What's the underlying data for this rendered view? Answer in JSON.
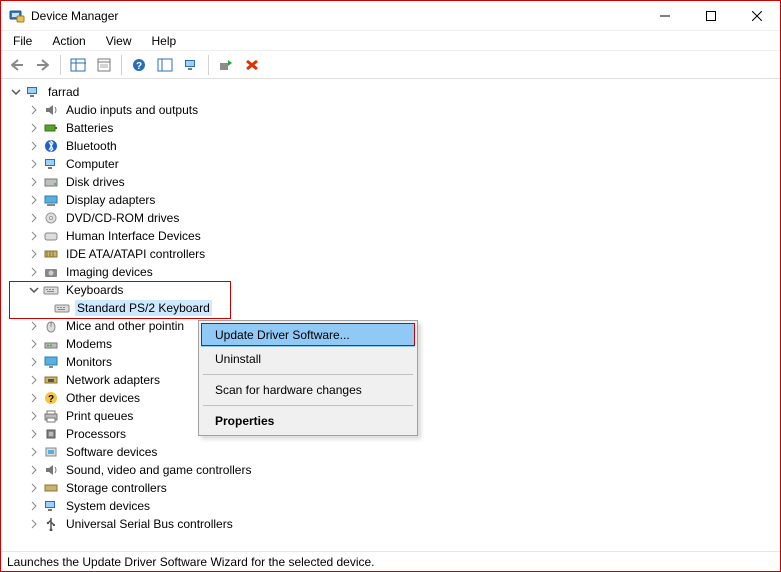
{
  "window": {
    "title": "Device Manager"
  },
  "menu": {
    "file": "File",
    "action": "Action",
    "view": "View",
    "help": "Help"
  },
  "tree": {
    "root": "farrad",
    "items": [
      "Audio inputs and outputs",
      "Batteries",
      "Bluetooth",
      "Computer",
      "Disk drives",
      "Display adapters",
      "DVD/CD-ROM drives",
      "Human Interface Devices",
      "IDE ATA/ATAPI controllers",
      "Imaging devices",
      "Keyboards",
      "Mice and other pointin",
      "Modems",
      "Monitors",
      "Network adapters",
      "Other devices",
      "Print queues",
      "Processors",
      "Software devices",
      "Sound, video and game controllers",
      "Storage controllers",
      "System devices",
      "Universal Serial Bus controllers"
    ],
    "keyboard_child": "Standard PS/2 Keyboard"
  },
  "context_menu": {
    "update": "Update Driver Software...",
    "uninstall": "Uninstall",
    "scan": "Scan for hardware changes",
    "properties": "Properties"
  },
  "status": "Launches the Update Driver Software Wizard for the selected device."
}
